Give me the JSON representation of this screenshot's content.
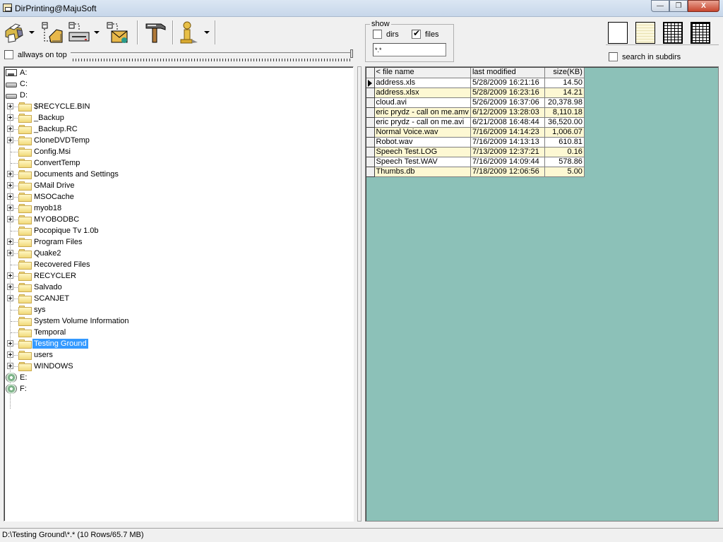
{
  "window": {
    "title": "DirPrinting@MajuSoft",
    "minimize_label": "—",
    "restore_label": "❐",
    "close_label": "X"
  },
  "toolbar": {
    "buttons": [
      {
        "name": "print",
        "icon": "printer-icon",
        "has_dropdown": true
      },
      {
        "name": "notepad",
        "icon": "notepad-icon",
        "has_dropdown": false
      },
      {
        "name": "export",
        "icon": "export-device-icon",
        "has_dropdown": true
      },
      {
        "name": "email",
        "icon": "email-icon",
        "has_dropdown": false
      },
      {
        "name": "tools",
        "icon": "hammer-icon",
        "has_dropdown": false
      },
      {
        "name": "info",
        "icon": "info-icon",
        "has_dropdown": true
      }
    ]
  },
  "always_on_top": {
    "label": "allways on top",
    "checked": false
  },
  "show": {
    "legend": "show",
    "dirs": {
      "label": "dirs",
      "checked": false
    },
    "files": {
      "label": "files",
      "checked": true
    },
    "mask": "*.*"
  },
  "views": [
    "plain-view",
    "striped-view",
    "grid-view",
    "grid-bold-view"
  ],
  "search_subdirs": {
    "label": "search in subdirs",
    "checked": false
  },
  "tree": {
    "drives": [
      {
        "label": "A:",
        "type": "floppy"
      },
      {
        "label": "C:",
        "type": "hdd"
      },
      {
        "label": "D:",
        "type": "hdd"
      }
    ],
    "folders": [
      {
        "label": "$RECYCLE.BIN",
        "expandable": true
      },
      {
        "label": "_Backup",
        "expandable": true
      },
      {
        "label": "_Backup.RC",
        "expandable": true
      },
      {
        "label": "CloneDVDTemp",
        "expandable": true
      },
      {
        "label": "Config.Msi",
        "expandable": false
      },
      {
        "label": "ConvertTemp",
        "expandable": false
      },
      {
        "label": "Documents and Settings",
        "expandable": true
      },
      {
        "label": "GMail Drive",
        "expandable": true
      },
      {
        "label": "MSOCache",
        "expandable": true
      },
      {
        "label": "myob18",
        "expandable": true
      },
      {
        "label": "MYOBODBC",
        "expandable": true
      },
      {
        "label": "Pocopique Tv 1.0b",
        "expandable": false
      },
      {
        "label": "Program Files",
        "expandable": true
      },
      {
        "label": "Quake2",
        "expandable": true
      },
      {
        "label": "Recovered Files",
        "expandable": false
      },
      {
        "label": "RECYCLER",
        "expandable": true
      },
      {
        "label": "Salvado",
        "expandable": true
      },
      {
        "label": "SCANJET",
        "expandable": true
      },
      {
        "label": "sys",
        "expandable": false
      },
      {
        "label": "System Volume Information",
        "expandable": false
      },
      {
        "label": "Temporal",
        "expandable": false
      },
      {
        "label": "Testing Ground",
        "expandable": true,
        "selected": true
      },
      {
        "label": "users",
        "expandable": true
      },
      {
        "label": "WINDOWS",
        "expandable": true
      }
    ],
    "drives_after": [
      {
        "label": "E:",
        "type": "cd"
      },
      {
        "label": "F:",
        "type": "cd"
      }
    ]
  },
  "file_table": {
    "columns": [
      "< file name",
      "last modified",
      "size(KB)"
    ],
    "rows": [
      {
        "name": "address.xls",
        "modified": "5/28/2009 16:21:16",
        "size": "14.50",
        "current": true
      },
      {
        "name": "address.xlsx",
        "modified": "5/28/2009 16:23:16",
        "size": "14.21"
      },
      {
        "name": "cloud.avi",
        "modified": "5/26/2009 16:37:06",
        "size": "20,378.98"
      },
      {
        "name": "eric prydz - call on me.amv",
        "modified": "6/12/2009 13:28:03",
        "size": "8,110.18"
      },
      {
        "name": "eric prydz - call on me.avi",
        "modified": "6/21/2008 16:48:44",
        "size": "36,520.00"
      },
      {
        "name": "Normal Voice.wav",
        "modified": "7/16/2009 14:14:23",
        "size": "1,006.07"
      },
      {
        "name": "Robot.wav",
        "modified": "7/16/2009 14:13:13",
        "size": "610.81"
      },
      {
        "name": "Speech Test.LOG",
        "modified": "7/13/2009 12:37:21",
        "size": "0.16"
      },
      {
        "name": "Speech Test.WAV",
        "modified": "7/16/2009 14:09:44",
        "size": "578.86"
      },
      {
        "name": "Thumbs.db",
        "modified": "7/18/2009 12:06:56",
        "size": "5.00"
      }
    ]
  },
  "colors": {
    "grid_background": "#8cc1b8",
    "row_alt": "#fdf8d3",
    "selection": "#3399ff"
  },
  "statusbar": {
    "text": "D:\\Testing Ground\\*.* (10 Rows/65.7 MB)"
  }
}
